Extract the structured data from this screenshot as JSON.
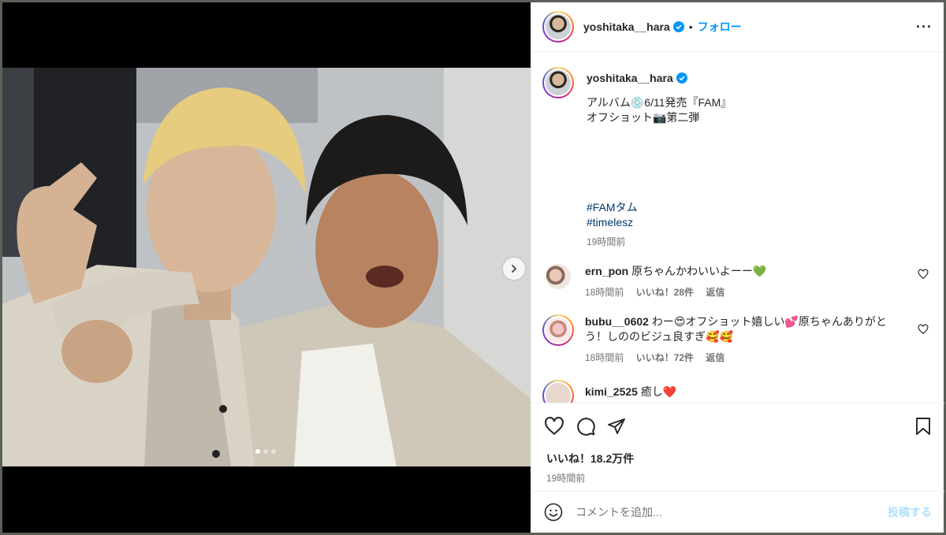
{
  "colors": {
    "accent": "#0095f6",
    "hashtag": "#00376b",
    "muted": "#737373",
    "text": "#262626"
  },
  "post": {
    "username": "yoshitaka__hara",
    "separator": "•",
    "follow_label": "フォロー",
    "more_icon": "more-icon",
    "carousel_next_icon": "chevron-right-icon",
    "carousel_dots": 3,
    "carousel_active_index": 0
  },
  "caption": {
    "username": "yoshitaka__hara",
    "line1": "アルバム💿6/11発売『FAM』",
    "line2": "オフショット📷第二弾",
    "hashtag1": "#FAMタム",
    "hashtag2": "#timelesz",
    "time": "19時間前"
  },
  "comments": [
    {
      "user": "ern_pon",
      "text": "原ちゃんかわいいよーー💚",
      "time": "18時間前",
      "likes": "いいね！28件",
      "reply": "返信"
    },
    {
      "user": "bubu__0602",
      "text": "わー😍オフショット嬉しい💕原ちゃんありがとう！しののビジュ良すぎ🥰🥰",
      "time": "18時間前",
      "likes": "いいね！72件",
      "reply": "返信"
    },
    {
      "user": "kimi_2525",
      "text": "癒し❤️",
      "time": "",
      "likes": "",
      "reply": ""
    }
  ],
  "actions": {
    "likes": "いいね！18.2万件",
    "time": "19時間前"
  },
  "add_comment": {
    "placeholder": "コメントを追加...",
    "post_label": "投稿する"
  }
}
